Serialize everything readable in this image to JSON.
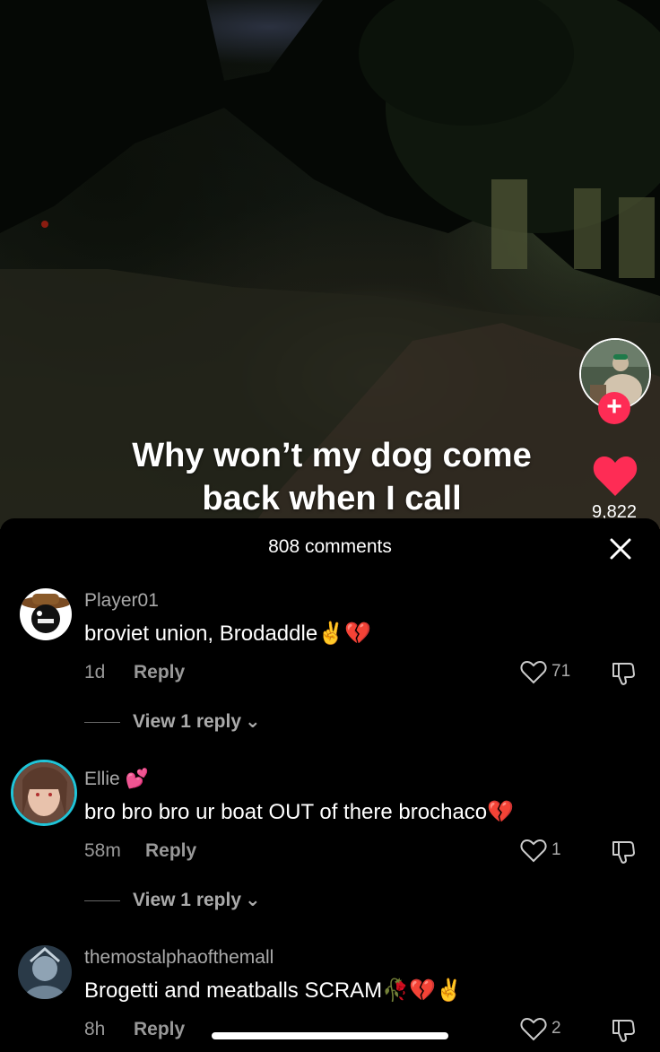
{
  "video": {
    "caption_line1": "Why won’t my dog come",
    "caption_line2": "back when I call",
    "like_count": "9,822",
    "accent_color": "#fe2c55"
  },
  "comments_sheet": {
    "title": "808 comments",
    "close_icon": "close-icon",
    "comments": [
      {
        "username": "Player01",
        "text": "broviet union, Brodaddle✌️💔",
        "time": "1d",
        "reply_label": "Reply",
        "like_count": "71",
        "view_replies": "View 1 reply"
      },
      {
        "username": "Ellie 💕",
        "text": "bro bro bro ur boat OUT of there brochaco💔",
        "time": "58m",
        "reply_label": "Reply",
        "like_count": "1",
        "view_replies": "View 1 reply"
      },
      {
        "username": "themostalphaofthemall",
        "text": "Brogetti and meatballs SCRAM🥀💔✌️",
        "time": "8h",
        "reply_label": "Reply",
        "like_count": "2"
      }
    ]
  }
}
